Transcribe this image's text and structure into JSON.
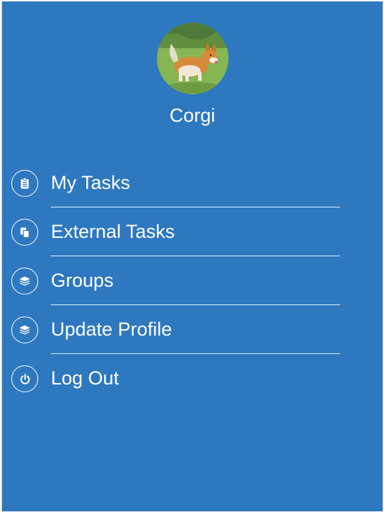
{
  "profile": {
    "name": "Corgi"
  },
  "menu": {
    "items": [
      {
        "label": "My Tasks",
        "icon": "clipboard-icon"
      },
      {
        "label": "External Tasks",
        "icon": "copy-icon"
      },
      {
        "label": "Groups",
        "icon": "layers-icon"
      },
      {
        "label": "Update Profile",
        "icon": "layers-icon"
      },
      {
        "label": "Log Out",
        "icon": "power-icon"
      }
    ]
  },
  "colors": {
    "sidebar_background": "#2e78bf",
    "text": "#ffffff"
  }
}
